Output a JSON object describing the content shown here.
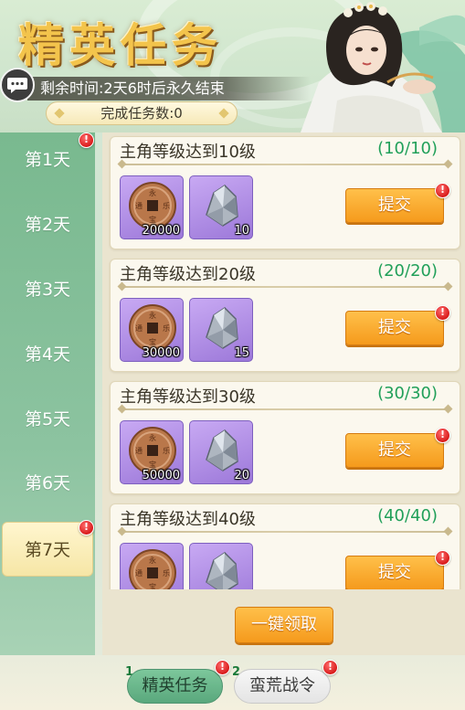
{
  "header": {
    "title": "精英任务",
    "time_remaining": "剩余时间:2天6时后永久结束",
    "completed_count": "完成任务数:0"
  },
  "sidebar": {
    "days": [
      {
        "label": "第1天",
        "badge": true,
        "active": false
      },
      {
        "label": "第2天",
        "badge": false,
        "active": false
      },
      {
        "label": "第3天",
        "badge": false,
        "active": false
      },
      {
        "label": "第4天",
        "badge": false,
        "active": false
      },
      {
        "label": "第5天",
        "badge": false,
        "active": false
      },
      {
        "label": "第6天",
        "badge": false,
        "active": false
      },
      {
        "label": "第7天",
        "badge": true,
        "active": true
      }
    ]
  },
  "tasks": [
    {
      "title": "主角等级达到10级",
      "progress": "(10/10)",
      "coin_qty": "20000",
      "stone_qty": "10",
      "button": "提交"
    },
    {
      "title": "主角等级达到20级",
      "progress": "(20/20)",
      "coin_qty": "30000",
      "stone_qty": "15",
      "button": "提交"
    },
    {
      "title": "主角等级达到30级",
      "progress": "(30/30)",
      "coin_qty": "50000",
      "stone_qty": "20",
      "button": "提交"
    },
    {
      "title": "主角等级达到40级",
      "progress": "(40/40)",
      "coin_qty": "",
      "stone_qty": "",
      "button": "提交"
    }
  ],
  "claim_all_label": "一键领取",
  "badge_text": "!",
  "bottom_tabs": [
    {
      "number": "1",
      "label": "精英任务",
      "active": true
    },
    {
      "number": "2",
      "label": "蛮荒战令",
      "active": false
    }
  ],
  "colors": {
    "progress_green": "#21a05a",
    "button_orange": "#f59a1c",
    "sidebar_green": "#79b98f",
    "item_purple": "#9c78d9",
    "badge_red": "#d81b1b",
    "title_gold": "#f3c44c"
  },
  "icons": {
    "chat": "speech-bubble-icon",
    "coin": "copper-coin-icon",
    "stone": "ore-stone-icon",
    "badge": "red-exclamation-badge-icon"
  }
}
